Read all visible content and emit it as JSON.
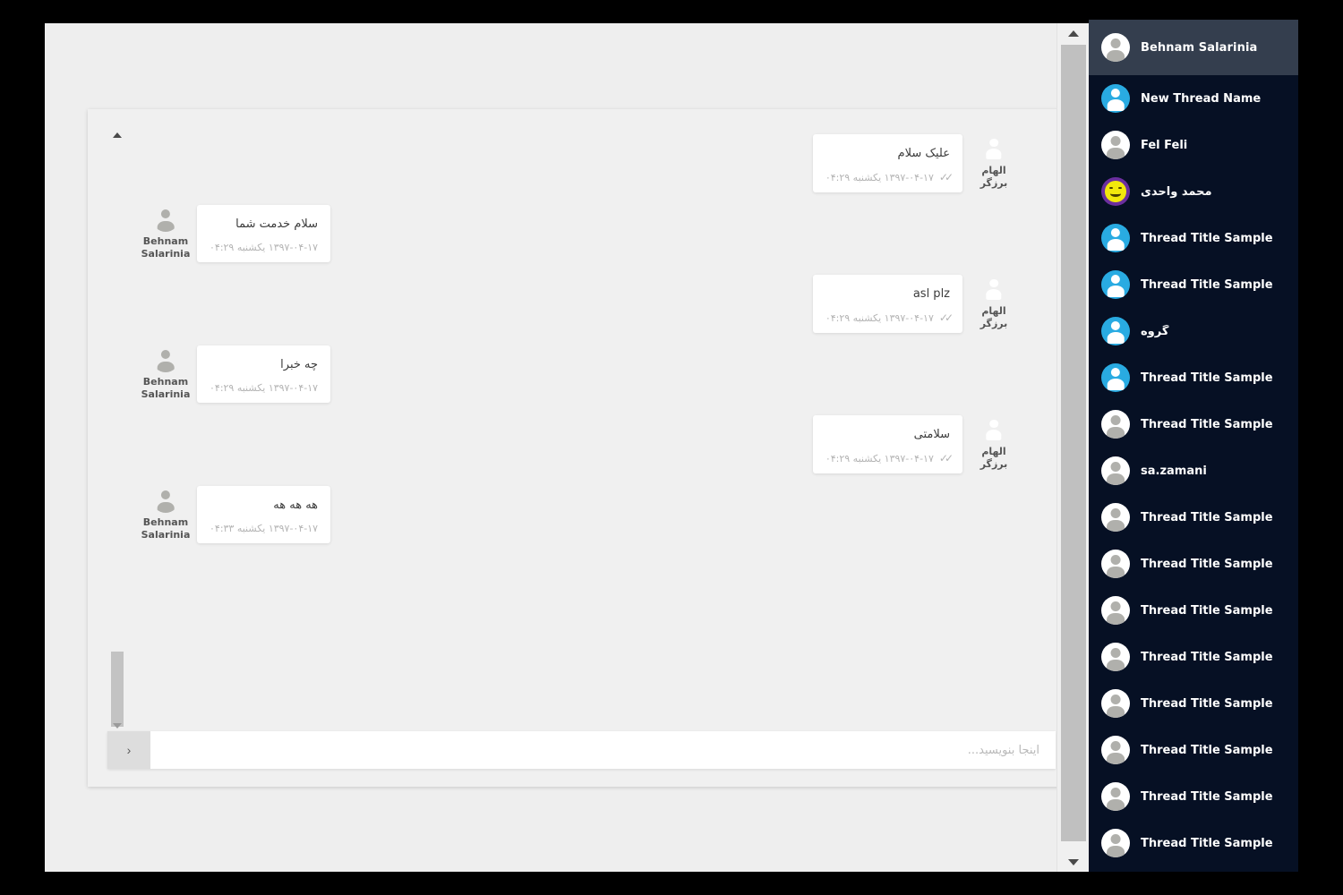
{
  "theme": {
    "page_bg": "#eeeeee",
    "sidebar_bg": "#061024",
    "sidebar_header_bg": "#343e4e",
    "accent_blue": "#29abe2",
    "bubble_bg": "#ffffff",
    "meta_text": "#b4b4b4",
    "emoji_avatar_bg": "#6b2f9e",
    "emoji_avatar_face": "#f2e80c"
  },
  "sidebar": {
    "current_user": {
      "name": "Behnam Salarinia",
      "avatar": "grey"
    },
    "threads": [
      {
        "title": "New Thread Name",
        "avatar": "blue",
        "rtl": false
      },
      {
        "title": "Fel Feli",
        "avatar": "grey",
        "rtl": false
      },
      {
        "title": "محمد واحدی",
        "avatar": "emoji",
        "rtl": true
      },
      {
        "title": "Thread Title Sample",
        "avatar": "blue",
        "rtl": false
      },
      {
        "title": "Thread Title Sample",
        "avatar": "blue",
        "rtl": false
      },
      {
        "title": "گروه",
        "avatar": "blue",
        "rtl": true
      },
      {
        "title": "Thread Title Sample",
        "avatar": "blue",
        "rtl": false
      },
      {
        "title": "Thread Title Sample",
        "avatar": "grey",
        "rtl": false
      },
      {
        "title": "sa.zamani",
        "avatar": "grey",
        "rtl": false
      },
      {
        "title": "Thread Title Sample",
        "avatar": "grey",
        "rtl": false
      },
      {
        "title": "Thread Title Sample",
        "avatar": "grey",
        "rtl": false
      },
      {
        "title": "Thread Title Sample",
        "avatar": "grey",
        "rtl": false
      },
      {
        "title": "Thread Title Sample",
        "avatar": "grey",
        "rtl": false
      },
      {
        "title": "Thread Title Sample",
        "avatar": "grey",
        "rtl": false
      },
      {
        "title": "Thread Title Sample",
        "avatar": "grey",
        "rtl": false
      },
      {
        "title": "Thread Title Sample",
        "avatar": "grey",
        "rtl": false
      },
      {
        "title": "Thread Title Sample",
        "avatar": "grey",
        "rtl": false
      }
    ]
  },
  "conversation": {
    "messages": [
      {
        "direction": "outgoing",
        "sender": "الهام برزگر",
        "avatar": "blue",
        "text": "علیک سلام",
        "ltr_text": false,
        "timestamp": "۱۳۹۷-۰۴-۱۷ یکشنبه ۰۴:۲۹",
        "read_ticks": "✓✓"
      },
      {
        "direction": "incoming",
        "sender": "Behnam Salarinia",
        "avatar": "grey",
        "text": "سلام خدمت شما",
        "ltr_text": false,
        "timestamp": "۱۳۹۷-۰۴-۱۷ یکشنبه ۰۴:۲۹",
        "read_ticks": ""
      },
      {
        "direction": "outgoing",
        "sender": "الهام برزگر",
        "avatar": "blue",
        "text": "asl plz",
        "ltr_text": true,
        "timestamp": "۱۳۹۷-۰۴-۱۷ یکشنبه ۰۴:۲۹",
        "read_ticks": "✓✓"
      },
      {
        "direction": "incoming",
        "sender": "Behnam Salarinia",
        "avatar": "grey",
        "text": "چه خبرا",
        "ltr_text": false,
        "timestamp": "۱۳۹۷-۰۴-۱۷ یکشنبه ۰۴:۲۹",
        "read_ticks": ""
      },
      {
        "direction": "outgoing",
        "sender": "الهام برزگر",
        "avatar": "blue",
        "text": "سلامتی",
        "ltr_text": false,
        "timestamp": "۱۳۹۷-۰۴-۱۷ یکشنبه ۰۴:۲۹",
        "read_ticks": "✓✓"
      },
      {
        "direction": "incoming",
        "sender": "Behnam Salarinia",
        "avatar": "grey",
        "text": "هه هه هه",
        "ltr_text": false,
        "timestamp": "۱۳۹۷-۰۴-۱۷ یکشنبه ۰۴:۳۳",
        "read_ticks": ""
      }
    ]
  },
  "composer": {
    "value": "",
    "placeholder": "اینجا بنویسید...",
    "send_label": "‹"
  },
  "scrollbars": {
    "page_up_arrow": "▲",
    "page_down_arrow": "▼",
    "inner_up_arrow": "▲",
    "inner_down_arrow": "▼"
  }
}
